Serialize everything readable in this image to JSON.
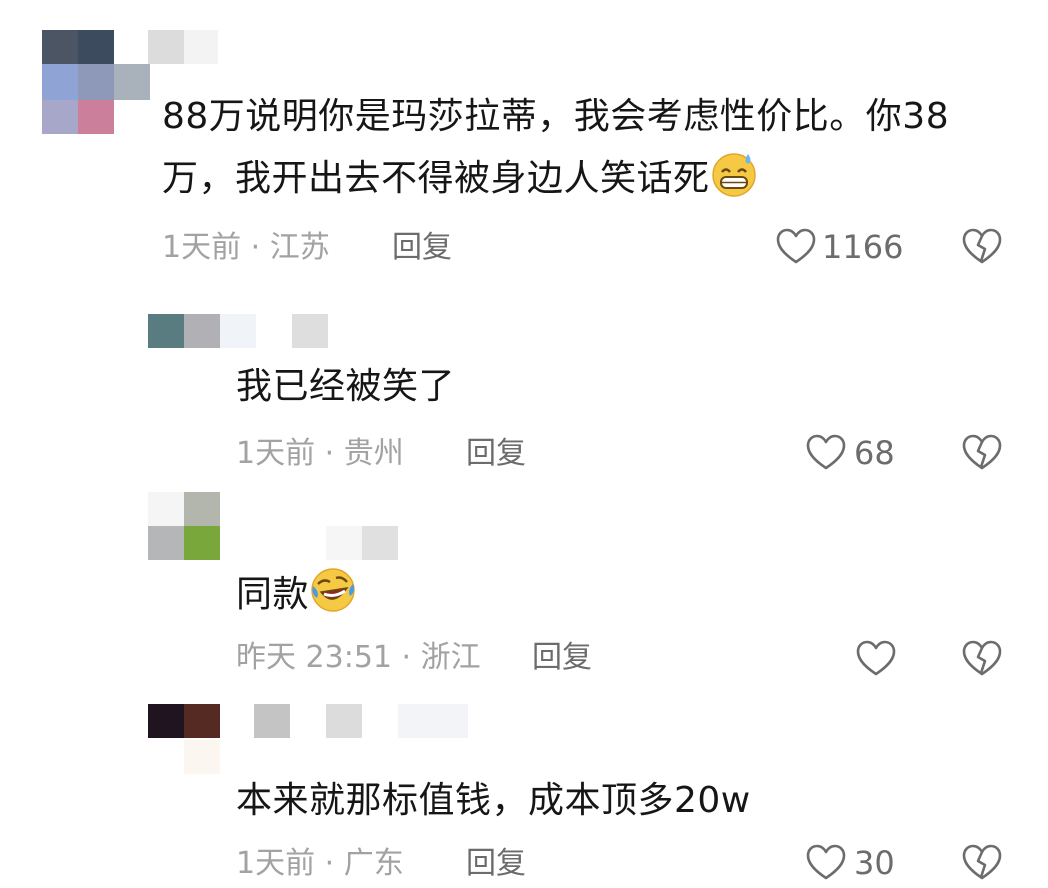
{
  "comments": [
    {
      "text_line1": "88万说明你是玛莎拉蒂，我会考虑性价比。你38",
      "text_line2": "万，我开出去不得被身边人笑话死",
      "emoji": "grinning-sweat-emoji",
      "time_location": "1天前 · 江苏",
      "reply_label": "回复",
      "likes": "1166"
    },
    {
      "text": "我已经被笑了",
      "time_location": "1天前 · 贵州",
      "reply_label": "回复",
      "likes": "68"
    },
    {
      "text": "同款",
      "emoji": "rolling-laughing-emoji",
      "time_location": "昨天 23:51 · 浙江",
      "reply_label": "回复",
      "likes": ""
    },
    {
      "text": "本来就那标值钱，成本顶多20w",
      "time_location": "1天前 · 广东",
      "reply_label": "回复",
      "likes": "30"
    }
  ],
  "icons": {
    "like": "heart-outline-icon",
    "dislike": "broken-heart-icon"
  },
  "colors": {
    "text": "#161616",
    "meta": "#a2a2a2",
    "action": "#6c6c6c"
  }
}
